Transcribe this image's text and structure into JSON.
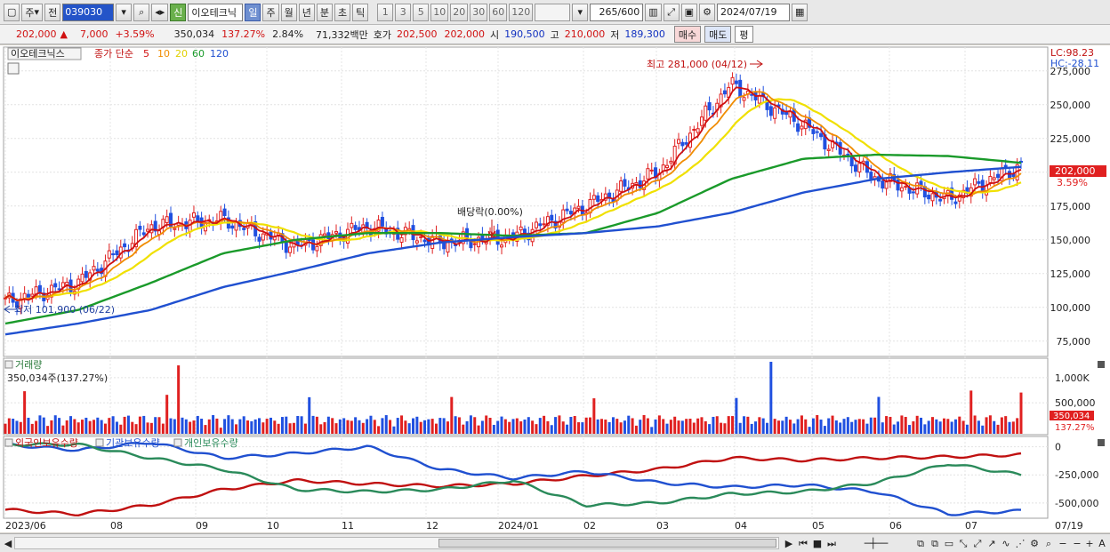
{
  "toolbar": {
    "market_select": "주",
    "prev_label": "전",
    "stock_code": "039030",
    "new_badge": "신",
    "stock_name": "이오테크닉",
    "periods": [
      "일",
      "주",
      "월",
      "년",
      "분",
      "초",
      "틱"
    ],
    "active_period": "일",
    "intervals": [
      "1",
      "3",
      "5",
      "10",
      "20",
      "30",
      "60",
      "120"
    ],
    "count_display": "265/600",
    "date_value": "2024/07/19"
  },
  "quote": {
    "price": "202,000",
    "change": "7,000",
    "change_pct": "+3.59%",
    "volume": "350,034",
    "volume_ratio": "137.27%",
    "turnover_pct": "2.84%",
    "amount": "71,332백만",
    "ask_label": "호가",
    "ask": "202,500",
    "bid": "202,000",
    "open_label": "시",
    "open": "190,500",
    "high_label": "고",
    "high": "210,000",
    "low_label": "저",
    "low": "189,300",
    "buy_label": "매수",
    "sell_label": "매도",
    "eval_label": "평"
  },
  "price_panel": {
    "legend_name": "이오테크닉스",
    "legend_ma": "종가 단순",
    "ma_periods": [
      {
        "label": "5",
        "color": "#d01010"
      },
      {
        "label": "10",
        "color": "#f08c00"
      },
      {
        "label": "20",
        "color": "#f0e000"
      },
      {
        "label": "60",
        "color": "#1a9a2a"
      },
      {
        "label": "120",
        "color": "#2050d0"
      }
    ],
    "lc_label": "LC:98.23",
    "hc_label": "HC:-28.11",
    "y_ticks": [
      "275,000",
      "250,000",
      "225,000",
      "200,000",
      "175,000",
      "150,000",
      "125,000",
      "100,000",
      "75,000"
    ],
    "current_price_tag": "202,000",
    "current_pct_tag": "3.59%",
    "high_annotation": "최고 281,000 (04/12)",
    "low_annotation": "최저 101,900 (06/22)",
    "dividend_annotation": "배당락(0.00%)"
  },
  "volume_panel": {
    "title": "거래량",
    "value_text": "350,034주(137.27%)",
    "y_ticks": [
      "1,000K",
      "500,000"
    ],
    "current_tag": "350,034",
    "current_pct_tag": "137.27%"
  },
  "holding_panel": {
    "legend": [
      {
        "label": "외국인보유수량",
        "color": "#c01010"
      },
      {
        "label": "기관보유수량",
        "color": "#2050d0"
      },
      {
        "label": "개인보유수량",
        "color": "#2a8a5a"
      }
    ],
    "y_ticks": [
      "0",
      "-250,000",
      "-500,000"
    ]
  },
  "x_axis": {
    "labels": [
      "2023/06",
      "08",
      "09",
      "10",
      "11",
      "12",
      "2024/01",
      "02",
      "03",
      "04",
      "05",
      "06",
      "07",
      "07/19"
    ]
  },
  "colors": {
    "up": "#e02020",
    "down": "#2050e0",
    "ma5": "#d01010",
    "ma10": "#f08c00",
    "ma20": "#f0e000",
    "ma60": "#1a9a2a",
    "ma120": "#2050d0"
  },
  "chart_data": {
    "type": "line",
    "title": "이오테크닉스",
    "ylabel": "",
    "xlabel": "",
    "ylim": [
      65000,
      290000
    ],
    "categories": [
      "2023/06",
      "07",
      "08",
      "09",
      "10",
      "11",
      "12",
      "2024/01",
      "02",
      "03",
      "04",
      "05",
      "06",
      "07",
      "07/19"
    ],
    "series": [
      {
        "name": "5",
        "values": [
          104000,
          118000,
          160000,
          165000,
          145000,
          160000,
          148000,
          152000,
          175000,
          200000,
          265000,
          235000,
          195000,
          180000,
          205000
        ]
      },
      {
        "name": "60",
        "values": [
          88000,
          98000,
          118000,
          140000,
          150000,
          155000,
          155000,
          153000,
          155000,
          170000,
          195000,
          210000,
          213000,
          212000,
          207000
        ]
      },
      {
        "name": "120",
        "values": [
          80000,
          88000,
          98000,
          115000,
          127000,
          140000,
          148000,
          152000,
          155000,
          160000,
          170000,
          185000,
          195000,
          200000,
          204000
        ]
      }
    ]
  }
}
